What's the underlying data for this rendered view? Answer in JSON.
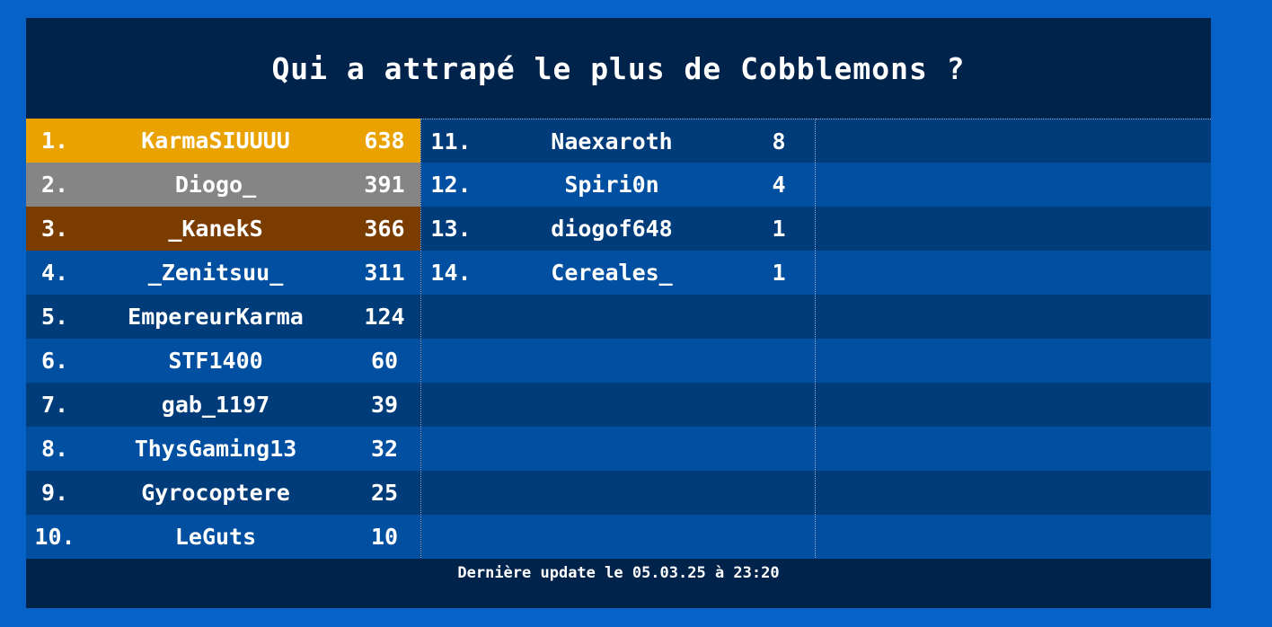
{
  "title": "Qui a attrapé le plus de Cobblemons ?",
  "footer": "Dernière update le 05.03.25 à 23:20",
  "colors": {
    "page_background": "#0762c8",
    "board_background": "#00234c",
    "row_dark": "#003c7a",
    "row_light": "#004fa0",
    "gold": "#e9a200",
    "silver": "#858585",
    "bronze": "#7b3c00"
  },
  "columns": [
    [
      {
        "rank": "1.",
        "name": "KarmaSIUUUU",
        "score": "638"
      },
      {
        "rank": "2.",
        "name": "Diogo_",
        "score": "391"
      },
      {
        "rank": "3.",
        "name": "_KanekS",
        "score": "366"
      },
      {
        "rank": "4.",
        "name": "_Zenitsuu_",
        "score": "311"
      },
      {
        "rank": "5.",
        "name": "EmpereurKarma",
        "score": "124"
      },
      {
        "rank": "6.",
        "name": "STF1400",
        "score": "60"
      },
      {
        "rank": "7.",
        "name": "gab_1197",
        "score": "39"
      },
      {
        "rank": "8.",
        "name": "ThysGaming13",
        "score": "32"
      },
      {
        "rank": "9.",
        "name": "Gyrocoptere",
        "score": "25"
      },
      {
        "rank": "10.",
        "name": "LeGuts",
        "score": "10"
      }
    ],
    [
      {
        "rank": "11.",
        "name": "Naexaroth",
        "score": "8"
      },
      {
        "rank": "12.",
        "name": "Spiri0n",
        "score": "4"
      },
      {
        "rank": "13.",
        "name": "diogof648",
        "score": "1"
      },
      {
        "rank": "14.",
        "name": "Cereales_",
        "score": "1"
      },
      {
        "rank": "",
        "name": "",
        "score": ""
      },
      {
        "rank": "",
        "name": "",
        "score": ""
      },
      {
        "rank": "",
        "name": "",
        "score": ""
      },
      {
        "rank": "",
        "name": "",
        "score": ""
      },
      {
        "rank": "",
        "name": "",
        "score": ""
      },
      {
        "rank": "",
        "name": "",
        "score": ""
      }
    ],
    [
      {
        "rank": "",
        "name": "",
        "score": ""
      },
      {
        "rank": "",
        "name": "",
        "score": ""
      },
      {
        "rank": "",
        "name": "",
        "score": ""
      },
      {
        "rank": "",
        "name": "",
        "score": ""
      },
      {
        "rank": "",
        "name": "",
        "score": ""
      },
      {
        "rank": "",
        "name": "",
        "score": ""
      },
      {
        "rank": "",
        "name": "",
        "score": ""
      },
      {
        "rank": "",
        "name": "",
        "score": ""
      },
      {
        "rank": "",
        "name": "",
        "score": ""
      },
      {
        "rank": "",
        "name": "",
        "score": ""
      }
    ]
  ]
}
